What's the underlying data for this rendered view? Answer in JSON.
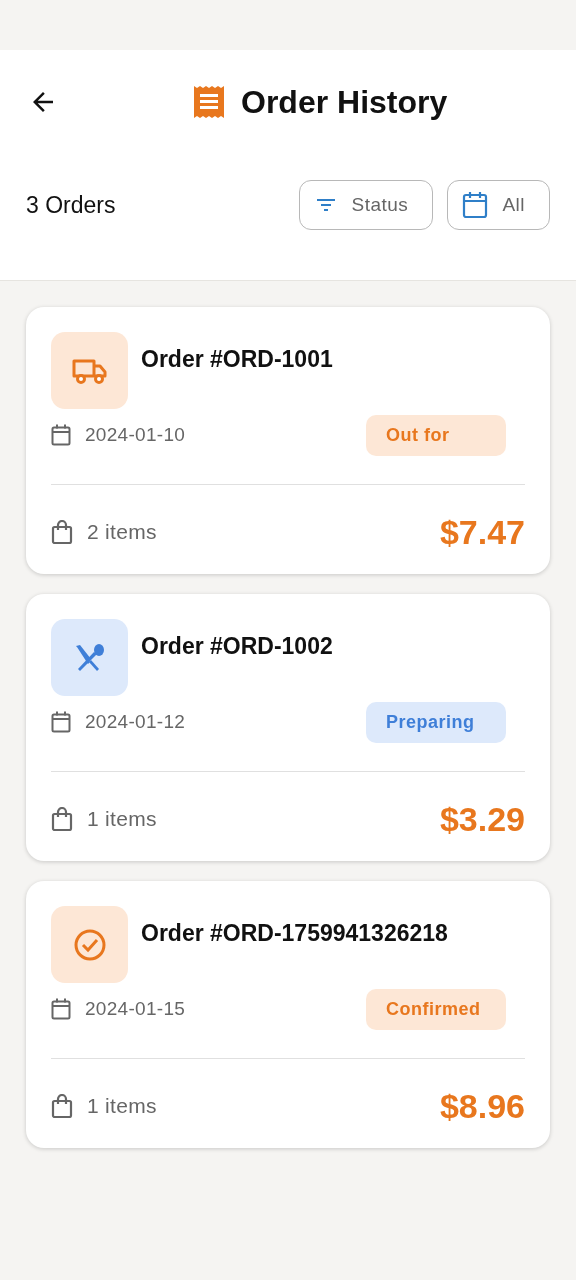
{
  "header": {
    "title": "Order History"
  },
  "summary": {
    "count_label": "3 Orders",
    "filters": [
      {
        "kind": "filter",
        "label": "Status"
      },
      {
        "kind": "calendar",
        "label": "All"
      }
    ]
  },
  "orders": [
    {
      "kind": "delivery",
      "title": "Order #ORD-1001",
      "date": "2024-01-10",
      "status": "Out for",
      "items": "2 items",
      "total": "$7.47"
    },
    {
      "kind": "preparing",
      "title": "Order #ORD-1002",
      "date": "2024-01-12",
      "status": "Preparing",
      "items": "1 items",
      "total": "$3.29"
    },
    {
      "kind": "confirmed",
      "title": "Order #ORD-1759941326218",
      "date": "2024-01-15",
      "status": "Confirmed",
      "items": "1 items",
      "total": "$8.96"
    }
  ]
}
